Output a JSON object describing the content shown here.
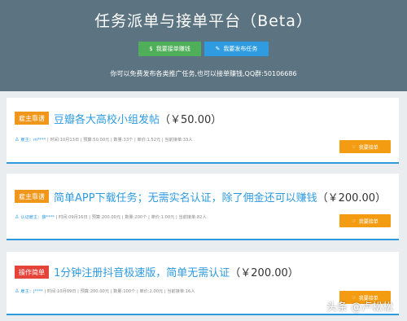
{
  "header": {
    "title": "任务派单与接单平台（Beta）",
    "accept_button": "我要接单赚钱",
    "publish_button": "我要发布任务",
    "note": "你可以免费发布各类推广任务,也可以接单赚钱,QQ群:50106686",
    "background": "#5c7381",
    "accept_color": "#4eae59",
    "publish_color": "#2f9be0"
  },
  "tasks": [
    {
      "badge": "雇主靠谱",
      "badge_color": "#f0961a",
      "title": "豆瓣各大高校小组发帖",
      "price": "（￥50.00）",
      "poster": "雇主：m****",
      "details": "| 时间:10月13日 | 预算:50.00元 | 数量:33个 | 单价:1.52元 | 当前接单:33人",
      "button": "我要接单"
    },
    {
      "badge": "雇主靠谱",
      "badge_color": "#f0961a",
      "title": "简单APP下载任务；无需实名认证，除了佣金还可以赚钱",
      "price": "（￥200.00）",
      "poster": "认证雇主：薛****",
      "details": "| 时间:09月16日 | 预算:200.00元 | 数量:200个 | 单价:1.00元 | 当前接单:82人",
      "button": "我要接单"
    },
    {
      "badge": "操作简单",
      "badge_color": "#e5443b",
      "title": "1分钟注册抖音极速版，简单无需认证",
      "price": "（￥200.00）",
      "poster": "雇主：j****",
      "details": "| 时间:10月09日 | 预算:200.00元 | 数量:100个 | 单价:2.00元 | 当前接单:16人",
      "button": "我要接单"
    }
  ],
  "watermark": "头条 @卢松松",
  "icons": {
    "accept": "dollar-icon",
    "publish": "edit-icon",
    "user": "user-icon",
    "take": "hand-icon"
  }
}
